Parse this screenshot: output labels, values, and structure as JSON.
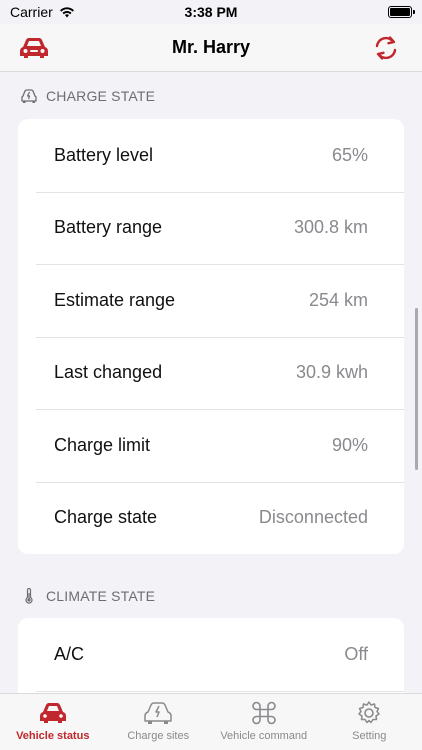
{
  "status_bar": {
    "carrier": "Carrier",
    "time": "3:38 PM"
  },
  "nav": {
    "title": "Mr. Harry",
    "left_icon": "car-icon",
    "right_icon": "refresh-icon"
  },
  "charge_state": {
    "header": "CHARGE STATE",
    "icon": "charging-car-icon",
    "rows": [
      {
        "label": "Battery level",
        "value": "65%"
      },
      {
        "label": "Battery range",
        "value": "300.8 km"
      },
      {
        "label": "Estimate range",
        "value": "254 km"
      },
      {
        "label": "Last changed",
        "value": "30.9 kwh"
      },
      {
        "label": "Charge limit",
        "value": "90%"
      },
      {
        "label": "Charge state",
        "value": "Disconnected"
      }
    ]
  },
  "climate_state": {
    "header": "CLIMATE STATE",
    "icon": "thermometer-icon",
    "rows": [
      {
        "label": "A/C",
        "value": "Off"
      }
    ]
  },
  "tabs": [
    {
      "label": "Vehicle status",
      "icon": "car-icon",
      "active": true
    },
    {
      "label": "Charge sites",
      "icon": "charging-car-icon",
      "active": false
    },
    {
      "label": "Vehicle command",
      "icon": "command-icon",
      "active": false
    },
    {
      "label": "Setting",
      "icon": "gear-icon",
      "active": false
    }
  ],
  "colors": {
    "accent": "#c0282d",
    "background": "#f2f2f7",
    "secondary_text": "#8a8a8e"
  }
}
